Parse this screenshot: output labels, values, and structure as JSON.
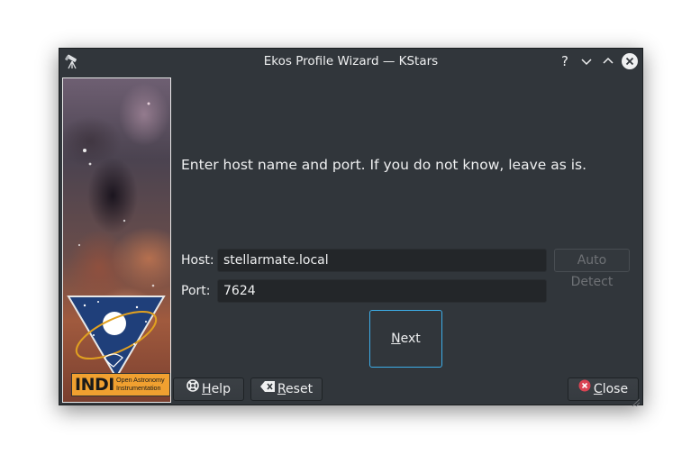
{
  "window": {
    "title": "Ekos Profile Wizard — KStars"
  },
  "titlebar": {
    "help_glyph": "?",
    "minimize_glyph": "⌄",
    "maximize_glyph": "⌃",
    "close_glyph": "✕"
  },
  "side_image": {
    "logo_text": "INDI",
    "logo_subtitle_line1": "Open Astronomy",
    "logo_subtitle_line2": "Instrumentation"
  },
  "page": {
    "instructions": "Enter host name and port. If you do not know, leave as is.",
    "host_label": "Host:",
    "host_value": "stellarmate.local",
    "port_label": "Port:",
    "port_value": "7624",
    "auto_detect_label": "Auto Detect",
    "next_mnemonic": "N",
    "next_rest": "ext"
  },
  "footer": {
    "help_mnemonic": "H",
    "help_rest": "elp",
    "reset_mnemonic": "R",
    "reset_rest": "eset",
    "close_mnemonic": "C",
    "close_rest": "lose"
  },
  "colors": {
    "window_bg": "#31363b",
    "field_bg": "#232629",
    "focus_accent": "#3daee9",
    "close_icon_red": "#da4453",
    "indi_label_bg": "#f0a030"
  },
  "icons": [
    "telescope-app-icon",
    "help-icon",
    "minimize-icon",
    "maximize-icon",
    "close-icon",
    "lifebuoy-help-icon",
    "clear-backspace-icon",
    "close-circle-icon"
  ]
}
